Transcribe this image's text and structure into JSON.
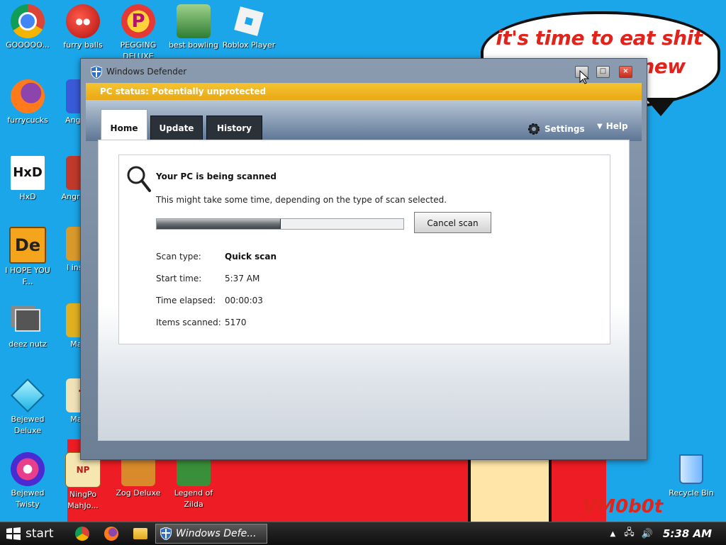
{
  "desktop": {
    "icons": [
      {
        "label": "GOOOOO...",
        "icon": "chrome-icon"
      },
      {
        "label": "furry balls",
        "icon": "red-ball-icon"
      },
      {
        "label": "PEGGING DELUXE",
        "icon": "peggle-icon"
      },
      {
        "label": "best bowling",
        "icon": "bowling-icon"
      },
      {
        "label": "Roblox Player",
        "icon": "roblox-icon"
      },
      {
        "label": "furrycucks",
        "icon": "firefox-icon"
      },
      {
        "label": "Angr Soy",
        "icon": "game-icon"
      },
      {
        "label": "HxD",
        "icon": "hxd-icon"
      },
      {
        "label": "Angr Soy V",
        "icon": "game-icon"
      },
      {
        "label": "I HOPE YOU F...",
        "icon": "de-icon"
      },
      {
        "label": "I ins this",
        "icon": "game-icon"
      },
      {
        "label": "deez nutz",
        "icon": "windows-stack-icon"
      },
      {
        "label": "Mal Es",
        "icon": "mahjong-icon"
      },
      {
        "label": "Bejewed Deluxe",
        "icon": "diamond-icon"
      },
      {
        "label": "Mal Es",
        "icon": "mahjong-icon"
      },
      {
        "label": "Bejewed Twisty",
        "icon": "gem-icon"
      },
      {
        "label": "NingPo MahJo...",
        "icon": "ningpo-icon"
      },
      {
        "label": "Zog Deluxe",
        "icon": "zuma-icon"
      },
      {
        "label": "Legend of Zilda",
        "icon": "link-icon"
      },
      {
        "label": "Recycle Bin",
        "icon": "recycle-bin-icon"
      }
    ],
    "wallpaper_bubble_line1": "it's time to eat shit",
    "wallpaper_bubble_line2": "new",
    "wallpaper_signature": "VM0b0t"
  },
  "window": {
    "title": "Windows Defender",
    "status": "PC status: Potentially unprotected",
    "tabs": [
      {
        "label": "Home"
      },
      {
        "label": "Update"
      },
      {
        "label": "History"
      }
    ],
    "settings_label": "Settings",
    "help_label": "Help",
    "scan": {
      "title": "Your PC is being scanned",
      "description": "This might take some time, depending on the type of scan selected.",
      "progress_percent": 50,
      "cancel_label": "Cancel scan",
      "rows": [
        {
          "label": "Scan type:",
          "value": "Quick scan"
        },
        {
          "label": "Start time:",
          "value": "5:37 AM"
        },
        {
          "label": "Time elapsed:",
          "value": "00:00:03"
        },
        {
          "label": "Items scanned:",
          "value": "5170"
        }
      ]
    }
  },
  "taskbar": {
    "start_label": "start",
    "task_label": "Windows Defe...",
    "clock": "5:38 AM"
  },
  "colors": {
    "desktop_blue": "#1ba6ea",
    "status_orange": "#f0b322",
    "wallpaper_red": "#ee1c24"
  }
}
